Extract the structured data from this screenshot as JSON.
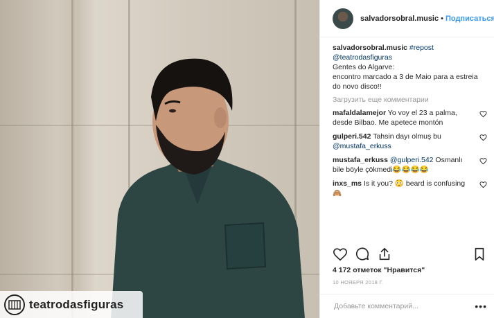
{
  "header": {
    "username": "salvadorsobral.music",
    "separator": "•",
    "follow_label": "Подписаться"
  },
  "caption": {
    "username": "salvadorsobral.music",
    "hashtag": "#repost",
    "mention": "@teatrodasfiguras",
    "line1": "Gentes do Algarve:",
    "line2": "encontro marcado a 3 de Maio para a estreia do novo disco!!"
  },
  "load_more_label": "Загрузить еще комментарии",
  "comments": [
    {
      "user": "mafaldalamejor",
      "text": "Yo voy el 23 a palma, desde Bilbao. Me apetece montón"
    },
    {
      "user": "gulperi.542",
      "text": "Tahsin dayı olmuş bu ",
      "mention": "@mustafa_erkuss"
    },
    {
      "user": "mustafa_erkuss",
      "mention": "@gulperi.542",
      "text": " Osmanlı bile böyle çökmedi😂😂😂😂"
    },
    {
      "user": "inxs_ms",
      "text": "Is it you? 😳 beard is confusing 🙈"
    }
  ],
  "likes_text": "4 172 отметок \"Нравится\"",
  "date_text": "10 НОЯБРЯ 2018 Г.",
  "add_comment_placeholder": "Добавьте комментарий...",
  "more_options": "•••",
  "photo": {
    "watermark_text": "teatrodasfiguras"
  },
  "icons": {
    "like": "heart-icon",
    "comment": "comment-bubble-icon",
    "share": "share-icon",
    "save": "bookmark-icon",
    "comment_like": "heart-icon"
  }
}
